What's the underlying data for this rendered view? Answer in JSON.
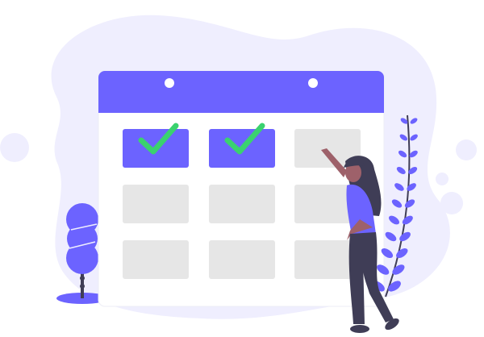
{
  "illustration": {
    "subject": "calendar-schedule",
    "colors": {
      "accent": "#6c63ff",
      "background_blob": "#efeefe",
      "cell": "#e6e6e6",
      "check": "#3ad26f",
      "dark": "#3f3d56",
      "skin": "#9e616a"
    },
    "calendar": {
      "rows": 3,
      "columns": 3,
      "checked_cells": [
        0,
        1
      ]
    }
  }
}
